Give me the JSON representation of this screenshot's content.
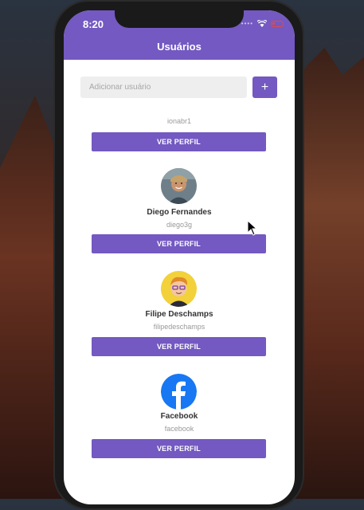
{
  "status_bar": {
    "time": "8:20",
    "dots": "••••"
  },
  "header": {
    "title": "Usuários"
  },
  "search": {
    "placeholder": "Adicionar usuário",
    "add_label": "+"
  },
  "partial_user": {
    "login": "jonabr1",
    "button_label": "VER PERFIL"
  },
  "users": [
    {
      "name": "Diego Fernandes",
      "login": "diego3g",
      "button_label": "VER PERFIL",
      "avatar": "photo-avatar"
    },
    {
      "name": "Filipe Deschamps",
      "login": "filipedeschamps",
      "button_label": "VER PERFIL",
      "avatar": "cartoon-avatar"
    },
    {
      "name": "Facebook",
      "login": "facebook",
      "button_label": "VER PERFIL",
      "avatar": "facebook-logo"
    }
  ],
  "colors": {
    "accent": "#7359c1",
    "facebook": "#1877f2",
    "background": "#ffffff"
  }
}
